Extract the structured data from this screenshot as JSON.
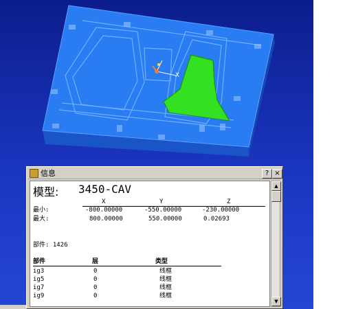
{
  "info_window": {
    "title": "信息",
    "help_button": "?",
    "close_button": "×",
    "model_label": "模型:",
    "model_name": "3450-CAV",
    "axes": [
      "X",
      "Y",
      "Z"
    ],
    "min_label": "最小:",
    "max_label": "最大:",
    "min_values": [
      "-800.00000",
      "-550.00000",
      "-230.00000"
    ],
    "max_values": [
      "800.00000",
      "550.00000",
      "0.02693"
    ],
    "parts_line": "部件: 1426",
    "table_headers": {
      "part": "部件",
      "layer": "层",
      "type": "类型"
    },
    "rows": [
      {
        "part": "ig3",
        "layer": "0",
        "type": "线框"
      },
      {
        "part": "ig5",
        "layer": "0",
        "type": "线框"
      },
      {
        "part": "ig7",
        "layer": "0",
        "type": "线框"
      },
      {
        "part": "ig9",
        "layer": "0",
        "type": "线框"
      }
    ]
  },
  "viewport": {
    "triad_label": "X",
    "colors": {
      "mold_top": "#2a7cf2",
      "mold_side": "#1c60d4",
      "highlight_face": "#33e022",
      "background": "#1428a8"
    }
  }
}
